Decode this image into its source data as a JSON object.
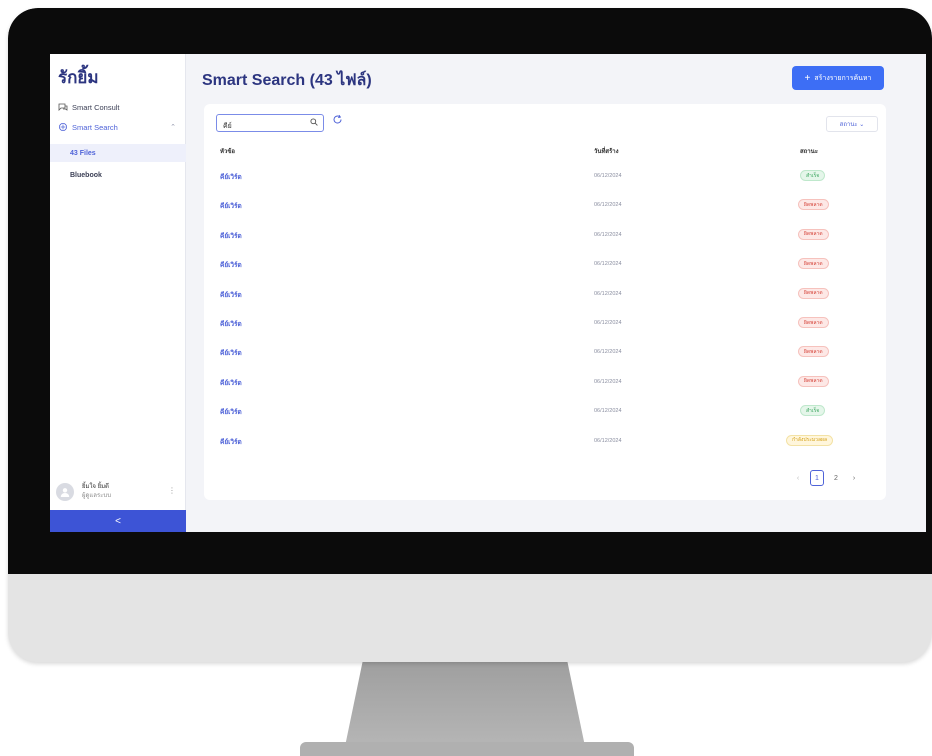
{
  "sidebar": {
    "brand": "รักยิ้ม",
    "nav": {
      "smart_consult": "Smart Consult",
      "smart_search": "Smart Search"
    },
    "sub_items": [
      "43 Files",
      "Bluebook"
    ],
    "user": {
      "name": "ยิ้มใจ ยิ้มดี",
      "role": "ผู้ดูแลระบบ"
    },
    "collapse_label": "<"
  },
  "header": {
    "title": "Smart Search (43 ไฟล์)",
    "create_button": "สร้างรายการค้นหา"
  },
  "toolbar": {
    "search_value": "คีย์",
    "status_filter": "สถานะ ⌄"
  },
  "table": {
    "columns": [
      "หัวข้อ",
      "วันที่สร้าง",
      "สถานะ"
    ],
    "rows": [
      {
        "title": "คีย์เวิร์ด",
        "date": "06/12/2024",
        "status": "สำเร็จ",
        "status_color": "green"
      },
      {
        "title": "คีย์เวิร์ด",
        "date": "06/12/2024",
        "status": "ผิดพลาด",
        "status_color": "red"
      },
      {
        "title": "คีย์เวิร์ด",
        "date": "06/12/2024",
        "status": "ผิดพลาด",
        "status_color": "red"
      },
      {
        "title": "คีย์เวิร์ด",
        "date": "06/12/2024",
        "status": "ผิดพลาด",
        "status_color": "red"
      },
      {
        "title": "คีย์เวิร์ด",
        "date": "06/12/2024",
        "status": "ผิดพลาด",
        "status_color": "red"
      },
      {
        "title": "คีย์เวิร์ด",
        "date": "06/12/2024",
        "status": "ผิดพลาด",
        "status_color": "red"
      },
      {
        "title": "คีย์เวิร์ด",
        "date": "06/12/2024",
        "status": "ผิดพลาด",
        "status_color": "red"
      },
      {
        "title": "คีย์เวิร์ด",
        "date": "06/12/2024",
        "status": "ผิดพลาด",
        "status_color": "red"
      },
      {
        "title": "คีย์เวิร์ด",
        "date": "06/12/2024",
        "status": "สำเร็จ",
        "status_color": "green"
      },
      {
        "title": "คีย์เวิร์ด",
        "date": "06/12/2024",
        "status": "กำลังประมวลผล",
        "status_color": "yellow"
      }
    ]
  },
  "pagination": {
    "prev": "‹",
    "pages": [
      "1",
      "2"
    ],
    "next": "›",
    "current": "1"
  },
  "icons": {
    "consult": "chat-icon",
    "search": "sparkle-icon",
    "search_box": "magnifier-icon",
    "refresh": "refresh-icon",
    "avatar": "user-avatar",
    "more": "kebab-icon"
  },
  "colors": {
    "brand_navy": "#2c3580",
    "accent_blue": "#3d6ef5",
    "sidebar_button": "#3d54d6",
    "status_success": "#36a35a",
    "status_error": "#d5453b",
    "status_pending": "#d4a017"
  }
}
